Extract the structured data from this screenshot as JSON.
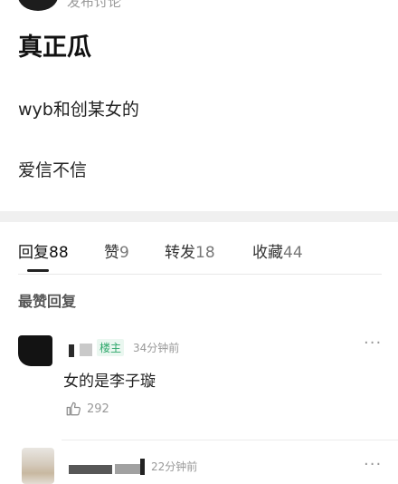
{
  "post": {
    "meta_text": "发布讨论",
    "title": "真正瓜",
    "lines": [
      "wyb和创某女的",
      "爱信不信"
    ]
  },
  "tabs": [
    {
      "label": "回复",
      "count": "88"
    },
    {
      "label": "赞",
      "count": "9"
    },
    {
      "label": "转发",
      "count": "18"
    },
    {
      "label": "收藏",
      "count": "44"
    }
  ],
  "section_title": "最赞回复",
  "comments": [
    {
      "badge": "楼主",
      "time": "34分钟前",
      "text": "女的是李子璇",
      "likes": "292",
      "more": "···"
    },
    {
      "time": "22分钟前",
      "more": "···"
    }
  ],
  "icons": {
    "like": "thumbs-up-icon",
    "more": "more-dots-icon"
  }
}
